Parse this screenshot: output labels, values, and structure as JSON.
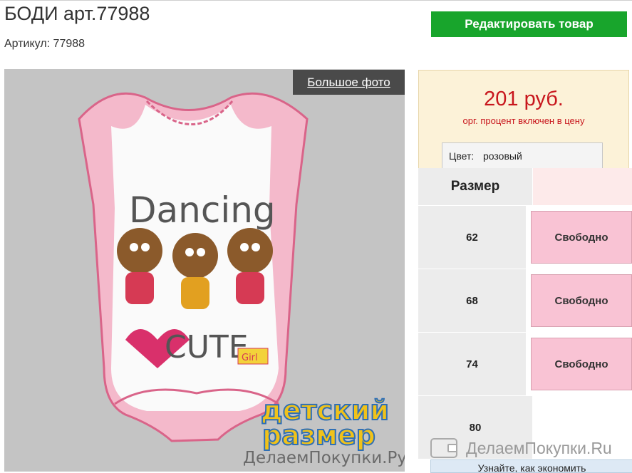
{
  "product": {
    "title": "БОДИ арт.77988",
    "article": "Артикул: 77988",
    "edit_label": "Редактировать товар",
    "big_photo_label": "Большое фото"
  },
  "photo": {
    "print_top": "Dancing",
    "print_bottom": "CUTE",
    "tag": "Girl",
    "watermark_line1": "детский",
    "watermark_line2": "размер",
    "watermark_site": "ДелаемПокупки.Ру"
  },
  "price": {
    "value": "201 руб.",
    "note": "орг. процент включен в цену"
  },
  "color": {
    "label": "Цвет:",
    "value": "розовый"
  },
  "sizes": {
    "header": "Размер",
    "rows": [
      {
        "size": "62",
        "status": "Свободно"
      },
      {
        "size": "68",
        "status": "Свободно"
      },
      {
        "size": "74",
        "status": "Свободно"
      },
      {
        "size": "80",
        "status": ""
      }
    ]
  },
  "footer": {
    "brand": "ДелаемПокупки.Ru",
    "save_tip": "Узнайте, как экономить"
  },
  "colors": {
    "accent_green": "#18a52c",
    "price_red": "#c8171d",
    "available_pink": "#f9c3d4"
  }
}
